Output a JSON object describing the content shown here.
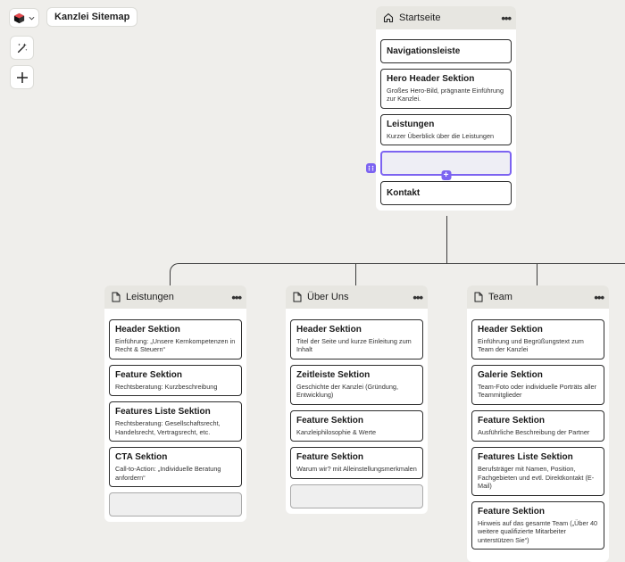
{
  "toolbar": {
    "title": "Kanzlei Sitemap",
    "logo_icon": "box-logo-icon",
    "dropdown_icon": "chevron-down-icon",
    "magic_icon": "magic-wand-icon",
    "add_icon": "plus-icon"
  },
  "colors": {
    "background": "#efeeeb",
    "header": "#e7e6e1",
    "accent": "#7c63f1",
    "logo_red": "#e5484d"
  },
  "home": {
    "title": "Startseite",
    "icon": "home-icon",
    "more": "•••",
    "cards": [
      {
        "title": "Navigationsleiste",
        "desc": ""
      },
      {
        "title": "Hero Header Sektion",
        "desc": "Großes Hero-Bild, prägnante Einführung zur Kanzlei."
      },
      {
        "title": "Leistungen",
        "desc": "Kurzer Überblick über die Leistungen"
      },
      {
        "title": "Kontakt",
        "desc": ""
      }
    ]
  },
  "pages": [
    {
      "title": "Leistungen",
      "icon": "page-icon",
      "more": "•••",
      "cards": [
        {
          "title": "Header Sektion",
          "desc": "Einführung: „Unsere Kernkompetenzen in Recht & Steuern“"
        },
        {
          "title": "Feature Sektion",
          "desc": "Rechtsberatung: Kurzbeschreibung"
        },
        {
          "title": "Features Liste Sektion",
          "desc": "Rechtsberatung: Gesellschaftsrecht, Handelsrecht, Vertragsrecht, etc."
        },
        {
          "title": "CTA Sektion",
          "desc": "Call-to-Action: „Individuelle Beratung anfordern“"
        }
      ]
    },
    {
      "title": "Über Uns",
      "icon": "page-icon",
      "more": "•••",
      "cards": [
        {
          "title": "Header Sektion",
          "desc": "Titel der Seite und kurze Einleitung zum Inhalt"
        },
        {
          "title": "Zeitleiste Sektion",
          "desc": "Geschichte der Kanzlei (Gründung, Entwicklung)"
        },
        {
          "title": "Feature Sektion",
          "desc": "Kanzleiphilosophie & Werte"
        },
        {
          "title": "Feature Sektion",
          "desc": "Warum wir? mit Alleinstellungsmerkmalen"
        }
      ]
    },
    {
      "title": "Team",
      "icon": "page-icon",
      "more": "•••",
      "cards": [
        {
          "title": "Header Sektion",
          "desc": "Einführung und Begrüßungstext zum Team der Kanzlei"
        },
        {
          "title": "Galerie Sektion",
          "desc": "Team-Foto oder individuelle Porträts aller Teammitglieder"
        },
        {
          "title": "Feature Sektion",
          "desc": "Ausführliche Beschreibung der Partner"
        },
        {
          "title": "Features Liste Sektion",
          "desc": "Berufsträger mit Namen, Position, Fachgebieten und evtl. Direktkontakt (E-Mail)"
        },
        {
          "title": "Feature Sektion",
          "desc": "Hinweis auf das gesamte Team („Über 40 weitere qualifizierte Mitarbeiter unterstützen Sie“)"
        }
      ]
    }
  ]
}
